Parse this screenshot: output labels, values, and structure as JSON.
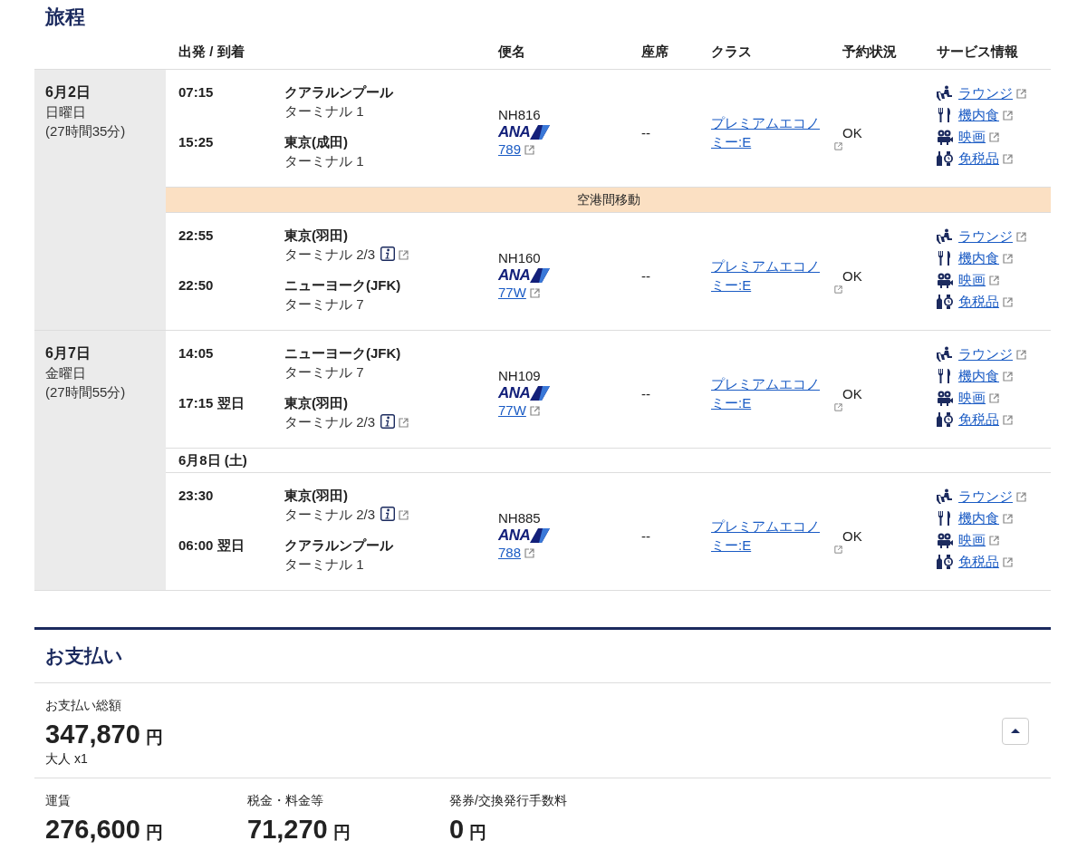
{
  "itinerary": {
    "title": "旅程",
    "columns": [
      "出発 / 到着",
      "便名",
      "座席",
      "クラス",
      "予約状況",
      "サービス情報"
    ],
    "days": [
      {
        "date": "6月2日",
        "weekday": "日曜日",
        "duration": "(27時間35分)",
        "items": [
          {
            "kind": "segment",
            "departure": {
              "time": "07:15",
              "airport": "クアラルンプール",
              "terminal": "ターミナル 1",
              "terminal_info": false
            },
            "arrival": {
              "time": "15:25",
              "airport": "東京(成田)",
              "terminal": "ターミナル 1",
              "terminal_info": false
            },
            "flight": "NH816",
            "airline_logo": "ANA",
            "aircraft": "789",
            "seat": "--",
            "class": "プレミアムエコノミー:E",
            "status": "OK",
            "services": [
              {
                "kind": "lounge",
                "label": "ラウンジ"
              },
              {
                "kind": "meal",
                "label": "機内食"
              },
              {
                "kind": "movie",
                "label": "映画"
              },
              {
                "kind": "dutyfree",
                "label": "免税品"
              }
            ]
          },
          {
            "kind": "transfer",
            "label": "空港間移動"
          },
          {
            "kind": "segment",
            "departure": {
              "time": "22:55",
              "airport": "東京(羽田)",
              "terminal": "ターミナル 2/3",
              "terminal_info": true
            },
            "arrival": {
              "time": "22:50",
              "airport": "ニューヨーク(JFK)",
              "terminal": "ターミナル 7",
              "terminal_info": false
            },
            "flight": "NH160",
            "airline_logo": "ANA",
            "aircraft": "77W",
            "seat": "--",
            "class": "プレミアムエコノミー:E",
            "status": "OK",
            "services": [
              {
                "kind": "lounge",
                "label": "ラウンジ"
              },
              {
                "kind": "meal",
                "label": "機内食"
              },
              {
                "kind": "movie",
                "label": "映画"
              },
              {
                "kind": "dutyfree",
                "label": "免税品"
              }
            ]
          }
        ]
      },
      {
        "date": "6月7日",
        "weekday": "金曜日",
        "duration": "(27時間55分)",
        "items": [
          {
            "kind": "segment",
            "departure": {
              "time": "14:05",
              "airport": "ニューヨーク(JFK)",
              "terminal": "ターミナル 7",
              "terminal_info": false
            },
            "arrival": {
              "time": "17:15 翌日",
              "airport": "東京(羽田)",
              "terminal": "ターミナル 2/3",
              "terminal_info": true
            },
            "flight": "NH109",
            "airline_logo": "ANA",
            "aircraft": "77W",
            "seat": "--",
            "class": "プレミアムエコノミー:E",
            "status": "OK",
            "services": [
              {
                "kind": "lounge",
                "label": "ラウンジ"
              },
              {
                "kind": "meal",
                "label": "機内食"
              },
              {
                "kind": "movie",
                "label": "映画"
              },
              {
                "kind": "dutyfree",
                "label": "免税品"
              }
            ]
          },
          {
            "kind": "date",
            "label": "6月8日 (土)"
          },
          {
            "kind": "segment",
            "departure": {
              "time": "23:30",
              "airport": "東京(羽田)",
              "terminal": "ターミナル 2/3",
              "terminal_info": true
            },
            "arrival": {
              "time": "06:00 翌日",
              "airport": "クアラルンプール",
              "terminal": "ターミナル 1",
              "terminal_info": false
            },
            "flight": "NH885",
            "airline_logo": "ANA",
            "aircraft": "788",
            "seat": "--",
            "class": "プレミアムエコノミー:E",
            "status": "OK",
            "services": [
              {
                "kind": "lounge",
                "label": "ラウンジ"
              },
              {
                "kind": "meal",
                "label": "機内食"
              },
              {
                "kind": "movie",
                "label": "映画"
              },
              {
                "kind": "dutyfree",
                "label": "免税品"
              }
            ]
          }
        ]
      }
    ]
  },
  "payment": {
    "title": "お支払い",
    "total": {
      "label": "お支払い総額",
      "amount": "347,870",
      "currency": "円",
      "passengers": "大人 x1"
    },
    "expanded": true,
    "breakdown": [
      {
        "label": "運賃",
        "amount": "276,600",
        "currency": "円"
      },
      {
        "label": "税金・料金等",
        "amount": "71,270",
        "currency": "円"
      },
      {
        "label": "発券/交換発行手数料",
        "amount": "0",
        "currency": "円"
      }
    ]
  }
}
